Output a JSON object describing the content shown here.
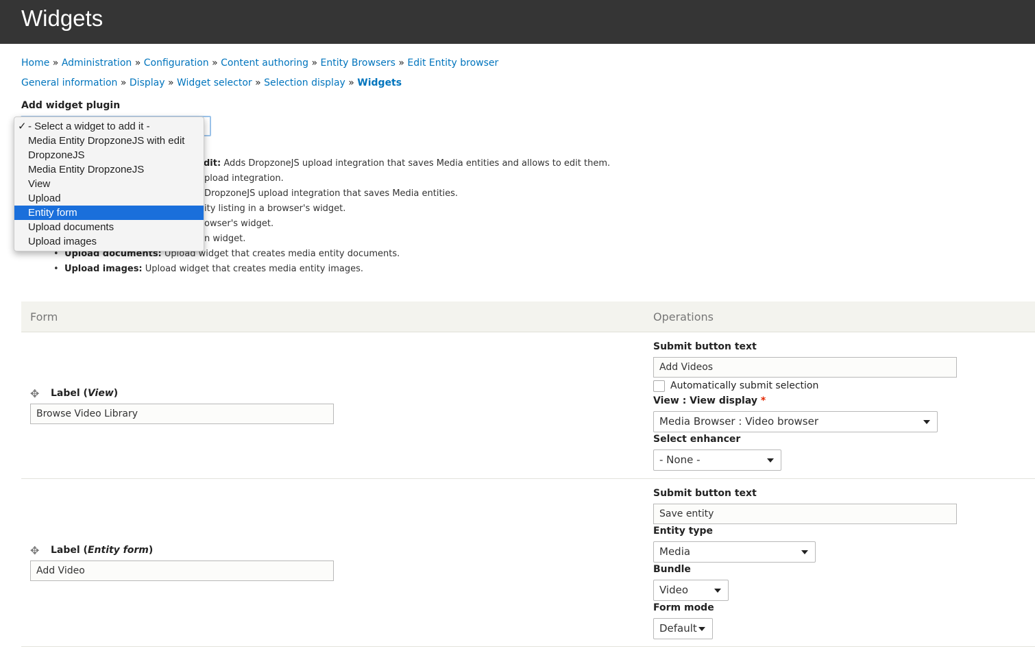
{
  "header": {
    "title": "Widgets"
  },
  "breadcrumb": [
    "Home",
    "Administration",
    "Configuration",
    "Content authoring",
    "Entity Browsers",
    "Edit Entity browser"
  ],
  "steps": [
    "General information",
    "Display",
    "Widget selector",
    "Selection display",
    "Widgets"
  ],
  "add_widget": {
    "label": "Add widget plugin",
    "selected": "- Select a widget to add it -",
    "options": [
      "- Select a widget to add it -",
      "Media Entity DropzoneJS with edit",
      "DropzoneJS",
      "Media Entity DropzoneJS",
      "View",
      "Upload",
      "Entity form",
      "Upload documents",
      "Upload images"
    ],
    "highlighted": "Entity form"
  },
  "descriptions_partial": [
    {
      "bold": "dit:",
      "text": " Adds DropzoneJS upload integration that saves Media entities and allows to edit them."
    },
    {
      "bold": "",
      "text": "pload integration."
    },
    {
      "bold": "",
      "text": "DropzoneJS upload integration that saves Media entities."
    },
    {
      "bold": "",
      "text": "ity listing in a browser's widget."
    },
    {
      "bold": "",
      "text": "owser's widget."
    },
    {
      "bold": "",
      "text": "n widget."
    }
  ],
  "descriptions": [
    {
      "name": "Upload documents:",
      "text": " Upload widget that creates media entity documents."
    },
    {
      "name": "Upload images:",
      "text": " Upload widget that creates media entity images."
    }
  ],
  "table": {
    "headers": [
      "Form",
      "Operations"
    ],
    "rows": [
      {
        "label": "Label",
        "plugin": "View",
        "value": "Browse Video Library",
        "submit_label": "Submit button text",
        "submit_value": "Add Videos",
        "auto_submit": "Automatically submit selection",
        "auto_submit_checked": false,
        "view_label": "View : View display",
        "view_value": "Media Browser : Video browser",
        "enhancer_label": "Select enhancer",
        "enhancer_value": "- None -"
      },
      {
        "label": "Label",
        "plugin": "Entity form",
        "value": "Add Video",
        "submit_label": "Submit button text",
        "submit_value": "Save entity",
        "entity_type_label": "Entity type",
        "entity_type_value": "Media",
        "bundle_label": "Bundle",
        "bundle_value": "Video",
        "form_mode_label": "Form mode",
        "form_mode_value": "Default"
      }
    ]
  },
  "colors": {
    "header_bg": "#353535",
    "link": "#0074bd",
    "highlight": "#1a6fdb",
    "required": "#e32700"
  }
}
